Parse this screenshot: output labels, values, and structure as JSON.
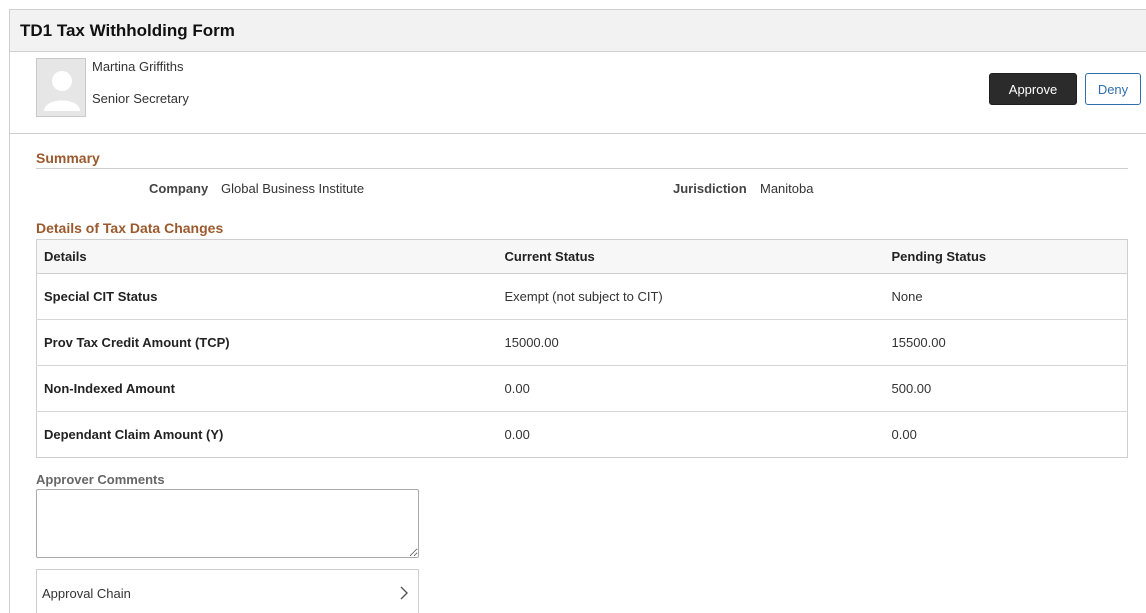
{
  "page": {
    "title": "TD1 Tax Withholding Form"
  },
  "employee": {
    "name": "Martina Griffiths",
    "job_title": "Senior Secretary"
  },
  "actions": {
    "approve_label": "Approve",
    "deny_label": "Deny"
  },
  "summary": {
    "heading": "Summary",
    "company_label": "Company",
    "company_value": "Global Business Institute",
    "jurisdiction_label": "Jurisdiction",
    "jurisdiction_value": "Manitoba"
  },
  "details": {
    "heading": "Details of Tax Data Changes",
    "columns": [
      "Details",
      "Current Status",
      "Pending Status"
    ],
    "rows": [
      {
        "detail": "Special CIT Status",
        "current": "Exempt (not subject to CIT)",
        "pending": "None"
      },
      {
        "detail": "Prov Tax Credit Amount (TCP)",
        "current": "15000.00",
        "pending": "15500.00"
      },
      {
        "detail": "Non-Indexed Amount",
        "current": "0.00",
        "pending": "500.00"
      },
      {
        "detail": "Dependant Claim Amount (Y)",
        "current": "0.00",
        "pending": "0.00"
      }
    ]
  },
  "comments": {
    "label": "Approver Comments",
    "value": ""
  },
  "approval_chain": {
    "label": "Approval Chain",
    "icon": "chevron-right-icon"
  },
  "colors": {
    "accent": "#9b5a2e",
    "approve_bg": "#2b2b2b",
    "deny_border": "#2f6fad"
  }
}
